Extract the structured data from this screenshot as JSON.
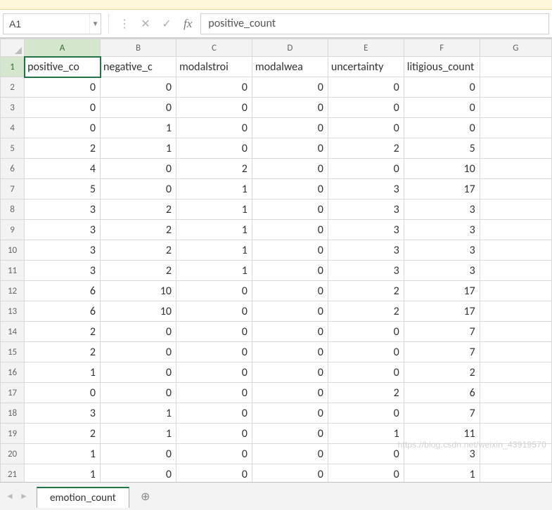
{
  "namebox": {
    "value": "A1"
  },
  "formula_bar": {
    "value": "positive_count"
  },
  "columns": [
    "A",
    "B",
    "C",
    "D",
    "E",
    "F",
    "G"
  ],
  "row_nums": [
    1,
    2,
    3,
    4,
    5,
    6,
    7,
    8,
    9,
    10,
    11,
    12,
    13,
    14,
    15,
    16,
    17,
    18,
    19,
    20,
    21
  ],
  "headers": [
    "positive_co",
    "negative_c",
    "modalstroi",
    "modalwea",
    "uncertainty",
    "litigious_count",
    ""
  ],
  "rows": [
    [
      "0",
      "0",
      "0",
      "0",
      "0",
      "0",
      ""
    ],
    [
      "0",
      "0",
      "0",
      "0",
      "0",
      "0",
      ""
    ],
    [
      "0",
      "1",
      "0",
      "0",
      "0",
      "0",
      ""
    ],
    [
      "2",
      "1",
      "0",
      "0",
      "2",
      "5",
      ""
    ],
    [
      "4",
      "0",
      "2",
      "0",
      "0",
      "10",
      ""
    ],
    [
      "5",
      "0",
      "1",
      "0",
      "3",
      "17",
      ""
    ],
    [
      "3",
      "2",
      "1",
      "0",
      "3",
      "3",
      ""
    ],
    [
      "3",
      "2",
      "1",
      "0",
      "3",
      "3",
      ""
    ],
    [
      "3",
      "2",
      "1",
      "0",
      "3",
      "3",
      ""
    ],
    [
      "3",
      "2",
      "1",
      "0",
      "3",
      "3",
      ""
    ],
    [
      "6",
      "10",
      "0",
      "0",
      "2",
      "17",
      ""
    ],
    [
      "6",
      "10",
      "0",
      "0",
      "2",
      "17",
      ""
    ],
    [
      "2",
      "0",
      "0",
      "0",
      "0",
      "7",
      ""
    ],
    [
      "2",
      "0",
      "0",
      "0",
      "0",
      "7",
      ""
    ],
    [
      "1",
      "0",
      "0",
      "0",
      "0",
      "2",
      ""
    ],
    [
      "0",
      "0",
      "0",
      "0",
      "2",
      "6",
      ""
    ],
    [
      "3",
      "1",
      "0",
      "0",
      "0",
      "7",
      ""
    ],
    [
      "2",
      "1",
      "0",
      "0",
      "1",
      "11",
      ""
    ],
    [
      "1",
      "0",
      "0",
      "0",
      "0",
      "3",
      ""
    ],
    [
      "1",
      "0",
      "0",
      "0",
      "0",
      "1",
      ""
    ]
  ],
  "sheet_tab": "emotion_count",
  "active_cell": {
    "row": 1,
    "col": 0
  },
  "watermark": "https://blog.csdn.net/weixin_43919570"
}
